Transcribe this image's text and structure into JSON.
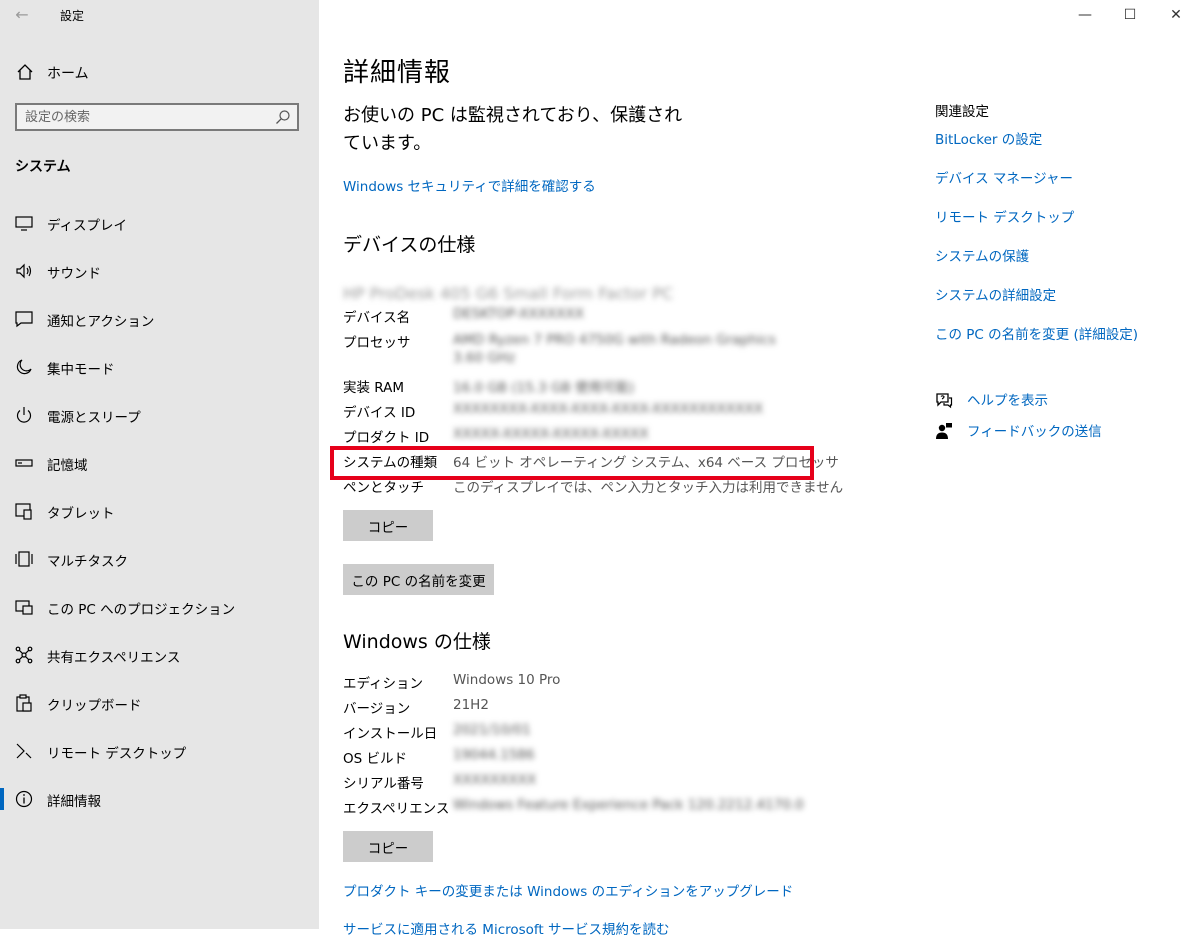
{
  "window": {
    "title": "設定",
    "back_glyph": "←",
    "min_glyph": "—",
    "max_glyph": "☐",
    "close_glyph": "✕"
  },
  "sidebar": {
    "home_label": "ホーム",
    "search_placeholder": "設定の検索",
    "section_label": "システム",
    "items": [
      {
        "label": "ディスプレイ",
        "icon": "monitor-icon"
      },
      {
        "label": "サウンド",
        "icon": "speaker-icon"
      },
      {
        "label": "通知とアクション",
        "icon": "notification-icon"
      },
      {
        "label": "集中モード",
        "icon": "moon-icon"
      },
      {
        "label": "電源とスリープ",
        "icon": "power-icon"
      },
      {
        "label": "記憶域",
        "icon": "storage-icon"
      },
      {
        "label": "タブレット",
        "icon": "tablet-icon"
      },
      {
        "label": "マルチタスク",
        "icon": "multitask-icon"
      },
      {
        "label": "この PC へのプロジェクション",
        "icon": "projection-icon"
      },
      {
        "label": "共有エクスペリエンス",
        "icon": "share-icon"
      },
      {
        "label": "クリップボード",
        "icon": "clipboard-icon"
      },
      {
        "label": "リモート デスクトップ",
        "icon": "remote-icon"
      },
      {
        "label": "詳細情報",
        "icon": "info-icon",
        "active": true
      }
    ]
  },
  "main": {
    "page_title": "詳細情報",
    "protection_text": "お使いの PC は監視されており、保護されています。",
    "security_link": "Windows セキュリティで詳細を確認する",
    "device_spec_heading": "デバイスの仕様",
    "device_model": "HP ProDesk 405 G6 Small Form Factor PC",
    "device_specs": [
      {
        "key": "デバイス名",
        "value": "DESKTOP-XXXXXXX"
      },
      {
        "key": "プロセッサ",
        "value": "AMD Ryzen 7 PRO 4750G with Radeon Graphics 3.60 GHz"
      },
      {
        "key": "実装 RAM",
        "value": "16.0 GB (15.3 GB 使用可能)"
      },
      {
        "key": "デバイス ID",
        "value": "XXXXXXXX-XXXX-XXXX-XXXX-XXXXXXXXXXXX"
      },
      {
        "key": "プロダクト ID",
        "value": "XXXXX-XXXXX-XXXXX-XXXXX"
      },
      {
        "key": "システムの種類",
        "value": "64 ビット オペレーティング システム、x64 ベース プロセッサ"
      },
      {
        "key": "ペンとタッチ",
        "value": "このディスプレイでは、ペン入力とタッチ入力は利用できません"
      }
    ],
    "copy_label": "コピー",
    "rename_label": "この PC の名前を変更",
    "windows_spec_heading": "Windows の仕様",
    "windows_specs": [
      {
        "key": "エディション",
        "value": "Windows 10 Pro"
      },
      {
        "key": "バージョン",
        "value": "21H2"
      },
      {
        "key": "インストール日",
        "value": "2021/10/01"
      },
      {
        "key": "OS ビルド",
        "value": "19044.1586"
      },
      {
        "key": "シリアル番号",
        "value": "XXXXXXXXX"
      },
      {
        "key": "エクスペリエンス",
        "value": "Windows Feature Experience Pack 120.2212.4170.0"
      }
    ],
    "upgrade_link": "プロダクト キーの変更または Windows のエディションをアップグレード",
    "terms_link": "サービスに適用される Microsoft サービス規約を読む"
  },
  "related": {
    "title": "関連設定",
    "links": [
      "BitLocker の設定",
      "デバイス マネージャー",
      "リモート デスクトップ",
      "システムの保護",
      "システムの詳細設定",
      "この PC の名前を変更 (詳細設定)"
    ],
    "help_label": "ヘルプを表示",
    "feedback_label": "フィードバックの送信"
  },
  "colors": {
    "accent": "#0067c0",
    "highlight_box": "#e6001a",
    "sidebar_bg": "#e6e6e6"
  }
}
